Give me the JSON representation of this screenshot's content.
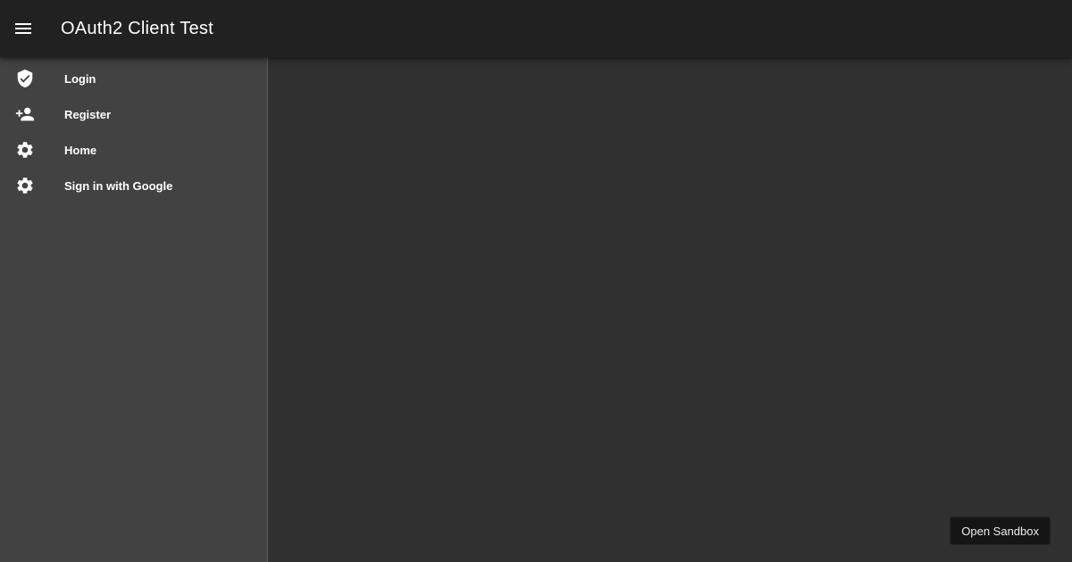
{
  "header": {
    "menu_icon": "menu-icon",
    "title": "OAuth2 Client Test"
  },
  "sidebar": {
    "items": [
      {
        "label": "Login",
        "icon": "verified-user-icon"
      },
      {
        "label": "Register",
        "icon": "person-add-icon"
      },
      {
        "label": "Home",
        "icon": "gear-icon"
      },
      {
        "label": "Sign in with Google",
        "icon": "gear-icon"
      }
    ]
  },
  "sandbox": {
    "label": "Open Sandbox"
  },
  "colors": {
    "toolbar": "#212121",
    "sidebar": "#424242",
    "content": "#303030",
    "text": "#ffffff"
  }
}
